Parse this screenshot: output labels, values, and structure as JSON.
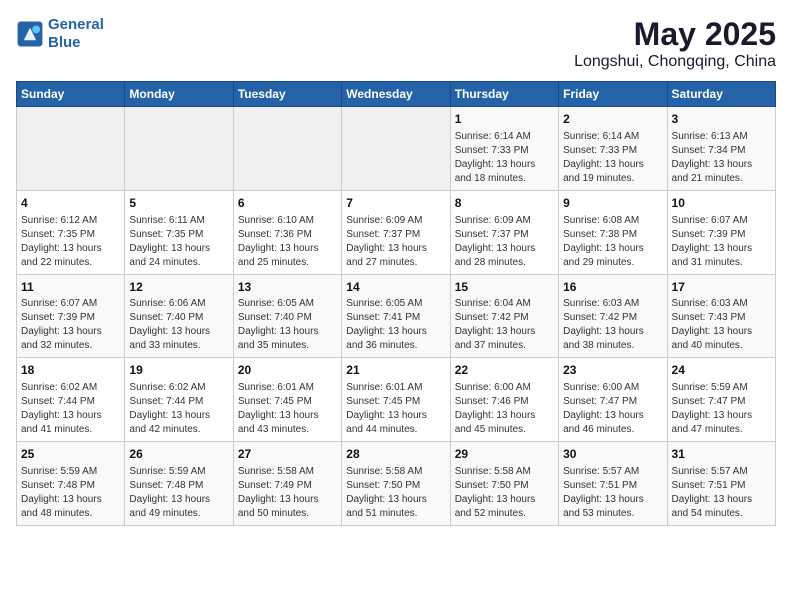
{
  "logo": {
    "line1": "General",
    "line2": "Blue"
  },
  "title": "May 2025",
  "subtitle": "Longshui, Chongqing, China",
  "days_of_week": [
    "Sunday",
    "Monday",
    "Tuesday",
    "Wednesday",
    "Thursday",
    "Friday",
    "Saturday"
  ],
  "weeks": [
    [
      {
        "day": "",
        "info": ""
      },
      {
        "day": "",
        "info": ""
      },
      {
        "day": "",
        "info": ""
      },
      {
        "day": "",
        "info": ""
      },
      {
        "day": "1",
        "info": "Sunrise: 6:14 AM\nSunset: 7:33 PM\nDaylight: 13 hours\nand 18 minutes."
      },
      {
        "day": "2",
        "info": "Sunrise: 6:14 AM\nSunset: 7:33 PM\nDaylight: 13 hours\nand 19 minutes."
      },
      {
        "day": "3",
        "info": "Sunrise: 6:13 AM\nSunset: 7:34 PM\nDaylight: 13 hours\nand 21 minutes."
      }
    ],
    [
      {
        "day": "4",
        "info": "Sunrise: 6:12 AM\nSunset: 7:35 PM\nDaylight: 13 hours\nand 22 minutes."
      },
      {
        "day": "5",
        "info": "Sunrise: 6:11 AM\nSunset: 7:35 PM\nDaylight: 13 hours\nand 24 minutes."
      },
      {
        "day": "6",
        "info": "Sunrise: 6:10 AM\nSunset: 7:36 PM\nDaylight: 13 hours\nand 25 minutes."
      },
      {
        "day": "7",
        "info": "Sunrise: 6:09 AM\nSunset: 7:37 PM\nDaylight: 13 hours\nand 27 minutes."
      },
      {
        "day": "8",
        "info": "Sunrise: 6:09 AM\nSunset: 7:37 PM\nDaylight: 13 hours\nand 28 minutes."
      },
      {
        "day": "9",
        "info": "Sunrise: 6:08 AM\nSunset: 7:38 PM\nDaylight: 13 hours\nand 29 minutes."
      },
      {
        "day": "10",
        "info": "Sunrise: 6:07 AM\nSunset: 7:39 PM\nDaylight: 13 hours\nand 31 minutes."
      }
    ],
    [
      {
        "day": "11",
        "info": "Sunrise: 6:07 AM\nSunset: 7:39 PM\nDaylight: 13 hours\nand 32 minutes."
      },
      {
        "day": "12",
        "info": "Sunrise: 6:06 AM\nSunset: 7:40 PM\nDaylight: 13 hours\nand 33 minutes."
      },
      {
        "day": "13",
        "info": "Sunrise: 6:05 AM\nSunset: 7:40 PM\nDaylight: 13 hours\nand 35 minutes."
      },
      {
        "day": "14",
        "info": "Sunrise: 6:05 AM\nSunset: 7:41 PM\nDaylight: 13 hours\nand 36 minutes."
      },
      {
        "day": "15",
        "info": "Sunrise: 6:04 AM\nSunset: 7:42 PM\nDaylight: 13 hours\nand 37 minutes."
      },
      {
        "day": "16",
        "info": "Sunrise: 6:03 AM\nSunset: 7:42 PM\nDaylight: 13 hours\nand 38 minutes."
      },
      {
        "day": "17",
        "info": "Sunrise: 6:03 AM\nSunset: 7:43 PM\nDaylight: 13 hours\nand 40 minutes."
      }
    ],
    [
      {
        "day": "18",
        "info": "Sunrise: 6:02 AM\nSunset: 7:44 PM\nDaylight: 13 hours\nand 41 minutes."
      },
      {
        "day": "19",
        "info": "Sunrise: 6:02 AM\nSunset: 7:44 PM\nDaylight: 13 hours\nand 42 minutes."
      },
      {
        "day": "20",
        "info": "Sunrise: 6:01 AM\nSunset: 7:45 PM\nDaylight: 13 hours\nand 43 minutes."
      },
      {
        "day": "21",
        "info": "Sunrise: 6:01 AM\nSunset: 7:45 PM\nDaylight: 13 hours\nand 44 minutes."
      },
      {
        "day": "22",
        "info": "Sunrise: 6:00 AM\nSunset: 7:46 PM\nDaylight: 13 hours\nand 45 minutes."
      },
      {
        "day": "23",
        "info": "Sunrise: 6:00 AM\nSunset: 7:47 PM\nDaylight: 13 hours\nand 46 minutes."
      },
      {
        "day": "24",
        "info": "Sunrise: 5:59 AM\nSunset: 7:47 PM\nDaylight: 13 hours\nand 47 minutes."
      }
    ],
    [
      {
        "day": "25",
        "info": "Sunrise: 5:59 AM\nSunset: 7:48 PM\nDaylight: 13 hours\nand 48 minutes."
      },
      {
        "day": "26",
        "info": "Sunrise: 5:59 AM\nSunset: 7:48 PM\nDaylight: 13 hours\nand 49 minutes."
      },
      {
        "day": "27",
        "info": "Sunrise: 5:58 AM\nSunset: 7:49 PM\nDaylight: 13 hours\nand 50 minutes."
      },
      {
        "day": "28",
        "info": "Sunrise: 5:58 AM\nSunset: 7:50 PM\nDaylight: 13 hours\nand 51 minutes."
      },
      {
        "day": "29",
        "info": "Sunrise: 5:58 AM\nSunset: 7:50 PM\nDaylight: 13 hours\nand 52 minutes."
      },
      {
        "day": "30",
        "info": "Sunrise: 5:57 AM\nSunset: 7:51 PM\nDaylight: 13 hours\nand 53 minutes."
      },
      {
        "day": "31",
        "info": "Sunrise: 5:57 AM\nSunset: 7:51 PM\nDaylight: 13 hours\nand 54 minutes."
      }
    ]
  ]
}
